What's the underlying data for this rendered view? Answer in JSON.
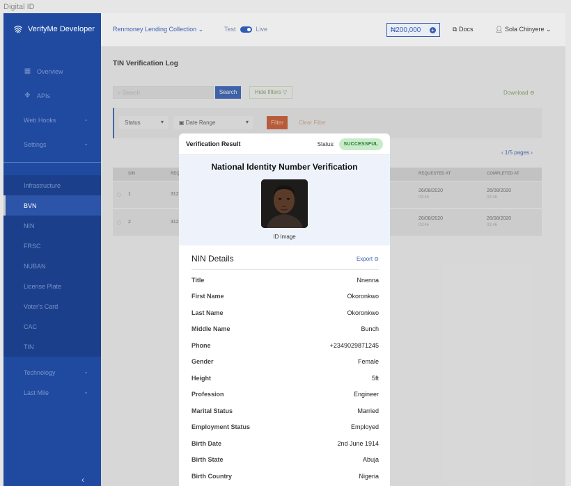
{
  "frame": {
    "label": "Digital ID"
  },
  "sidebar": {
    "brand": "VerifyMe Developer",
    "top_items": [
      {
        "label": "Overview",
        "icon": "grid-icon"
      },
      {
        "label": "APIs",
        "icon": "api-icon"
      },
      {
        "label": "Web Hooks",
        "icon": "chevron-down-icon"
      },
      {
        "label": "Settings",
        "icon": "chevron-down-icon"
      }
    ],
    "sub_items": [
      {
        "label": "Infrastructure"
      },
      {
        "label": "BVN",
        "active": true
      },
      {
        "label": "NIN"
      },
      {
        "label": "FRSC"
      },
      {
        "label": "NUBAN"
      },
      {
        "label": "License Plate"
      },
      {
        "label": "Voter's Card"
      },
      {
        "label": "CAC"
      },
      {
        "label": "TIN"
      }
    ],
    "bottom_items": [
      {
        "label": "Technology"
      },
      {
        "label": "Last Mile"
      }
    ]
  },
  "header": {
    "org": "Renmoney Lending Collection",
    "env_test": "Test",
    "env_live": "Live",
    "balance": "₦200,000",
    "docs": "Docs",
    "user": "Sola Chinyere"
  },
  "main": {
    "title": "TIN Verification Log",
    "search_placeholder": "Search",
    "search_button": "Search",
    "hide_filters": "Hide filters",
    "download": "Download",
    "status_select": "Status",
    "date_select": "Date Range",
    "filter_button": "Filter",
    "clear_filter": "Clear Filter",
    "pages": "1/5 pages",
    "columns": [
      "S/N",
      "REQ",
      "REQUESTED AT",
      "COMPLETED AT"
    ],
    "rows": [
      {
        "sn": "1",
        "req": "312",
        "requested": "26/08/2020",
        "requested_time": "03:46",
        "completed": "26/08/2020",
        "completed_time": "03:46"
      },
      {
        "sn": "2",
        "req": "312",
        "requested": "26/08/2020",
        "requested_time": "03:46",
        "completed": "26/08/2020",
        "completed_time": "03:46"
      }
    ]
  },
  "modal": {
    "title": "Verification Result",
    "status_label": "Status:",
    "status_value": "SUCCESSFUL",
    "heading": "National Identity Number Verification",
    "photo_caption": "ID Image",
    "details_title": "NIN Details",
    "export": "Export",
    "fields": [
      {
        "label": "Title",
        "value": "Nnenna"
      },
      {
        "label": "First Name",
        "value": "Okoronkwo"
      },
      {
        "label": "Last Name",
        "value": "Okoronkwo"
      },
      {
        "label": "Middle Name",
        "value": "Bunch"
      },
      {
        "label": "Phone",
        "value": "+2349029871245"
      },
      {
        "label": "Gender",
        "value": "Female"
      },
      {
        "label": "Height",
        "value": "5ft"
      },
      {
        "label": "Profession",
        "value": "Engineer"
      },
      {
        "label": "Marital Status",
        "value": "Married"
      },
      {
        "label": "Employment Status",
        "value": "Employed"
      },
      {
        "label": "Birth Date",
        "value": "2nd June 1914"
      },
      {
        "label": "Birth State",
        "value": "Abuja"
      },
      {
        "label": "Birth Country",
        "value": "Nigeria"
      }
    ]
  },
  "colors": {
    "sidebar_bg": "#1f4aa0",
    "accent": "#2f5bb5",
    "success_bg": "#c8ecc9",
    "success_text": "#2d7a32",
    "filter_button": "#c9552a"
  }
}
